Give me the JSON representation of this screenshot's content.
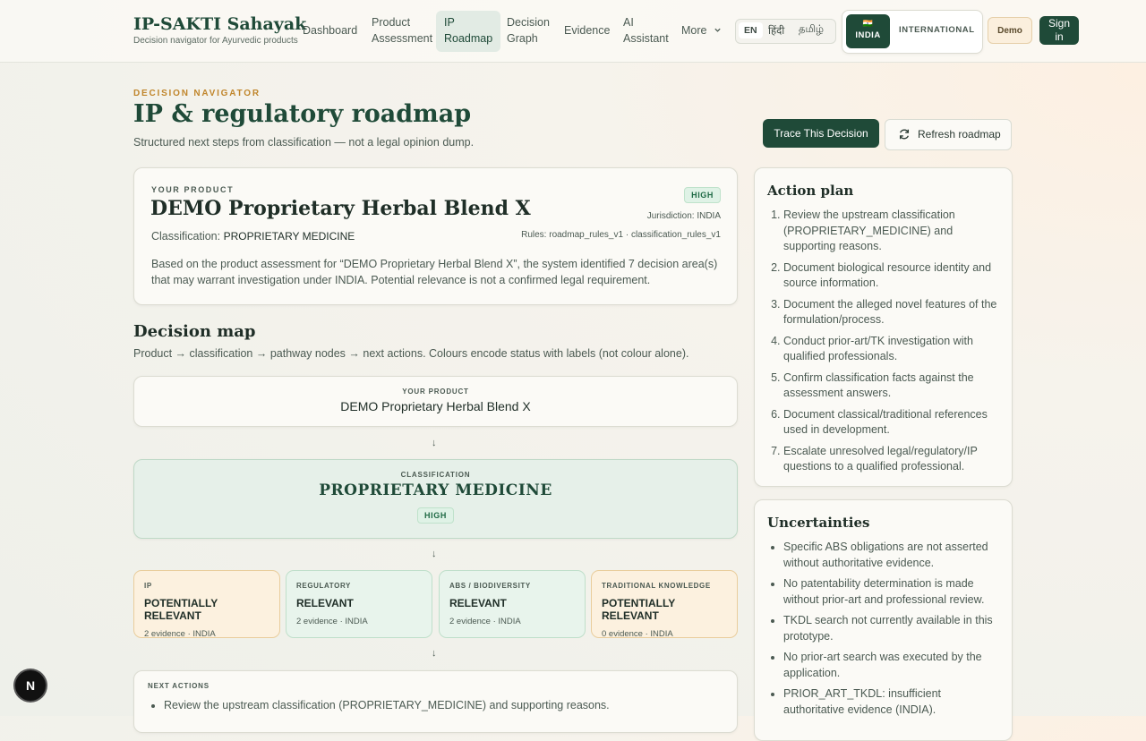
{
  "brand": {
    "title": "IP-SAKTI Sahayak",
    "subtitle": "Decision navigator for Ayurvedic products"
  },
  "nav": {
    "items": [
      {
        "label": "Dashboard"
      },
      {
        "label": "Product\nAssessment"
      },
      {
        "label": "IP\nRoadmap"
      },
      {
        "label": "Decision\nGraph"
      },
      {
        "label": "Evidence"
      },
      {
        "label": "AI\nAssistant"
      },
      {
        "label": "More"
      }
    ],
    "languages": [
      "EN",
      "हिंदी",
      "தமிழ்"
    ],
    "jurisdiction": {
      "flag": "🇮🇳",
      "active": "INDIA",
      "other": "INTERNATIONAL"
    },
    "demo_label": "Demo",
    "signin_label": "Sign\nin"
  },
  "header": {
    "eyebrow": "DECISION NAVIGATOR",
    "title": "IP & regulatory roadmap",
    "subtitle": "Structured next steps from classification — not a legal opinion dump.",
    "trace_button": "Trace This Decision",
    "refresh_button": "Refresh roadmap"
  },
  "product_card": {
    "kicker": "YOUR PRODUCT",
    "name": "DEMO Proprietary Herbal Blend X",
    "classification_label": "Classification:",
    "classification": "PROPRIETARY MEDICINE",
    "confidence": "HIGH",
    "jurisdiction": "Jurisdiction: INDIA",
    "rules": "Rules: roadmap_rules_v1 · classification_rules_v1",
    "summary": "Based on the product assessment for “DEMO Proprietary Herbal Blend X”, the system identified 7 decision area(s) that may warrant investigation under INDIA. Potential relevance is not a confirmed legal requirement."
  },
  "decision_map": {
    "title": "Decision map",
    "subtitle": "Product → classification → pathway nodes → next actions. Colours encode status with labels (not colour alone).",
    "product_node": {
      "kicker": "YOUR PRODUCT",
      "name": "DEMO Proprietary Herbal Blend X"
    },
    "classification_node": {
      "kicker": "CLASSIFICATION",
      "name": "PROPRIETARY MEDICINE",
      "confidence": "HIGH"
    },
    "pathways": [
      {
        "kind": "IP",
        "status": "POTENTIALLY RELEVANT",
        "evidence": "2 evidence · INDIA",
        "tone": "warn"
      },
      {
        "kind": "REGULATORY",
        "status": "RELEVANT",
        "evidence": "2 evidence · INDIA",
        "tone": "ok"
      },
      {
        "kind": "ABS / BIODIVERSITY",
        "status": "RELEVANT",
        "evidence": "2 evidence · INDIA",
        "tone": "ok"
      },
      {
        "kind": "TRADITIONAL KNOWLEDGE",
        "status": "POTENTIALLY RELEVANT",
        "evidence": "0 evidence · INDIA",
        "tone": "warn"
      }
    ],
    "next_actions": {
      "kicker": "NEXT ACTIONS",
      "items": [
        "Review the upstream classification (PROPRIETARY_MEDICINE) and supporting reasons."
      ]
    }
  },
  "action_plan": {
    "title": "Action plan",
    "items": [
      "Review the upstream classification (PROPRIETARY_MEDICINE) and supporting reasons.",
      "Document biological resource identity and source information.",
      "Document the alleged novel features of the formulation/process.",
      "Conduct prior-art/TK investigation with qualified professionals.",
      "Confirm classification facts against the assessment answers.",
      "Document classical/traditional references used in development.",
      "Escalate unresolved legal/regulatory/IP questions to a qualified professional."
    ]
  },
  "uncertainties": {
    "title": "Uncertainties",
    "items": [
      "Specific ABS obligations are not asserted without authoritative evidence.",
      "No patentability determination is made without prior-art and professional review.",
      "TKDL search not currently available in this prototype.",
      "No prior-art search was executed by the application.",
      "PRIOR_ART_TKDL: insufficient authoritative evidence (INDIA)."
    ]
  },
  "fab_label": "N",
  "colors": {
    "primary": "#1f4a38",
    "accent": "#c0862c",
    "ok_bg": "#e8f4ec",
    "warn_bg": "#fcf1df"
  }
}
